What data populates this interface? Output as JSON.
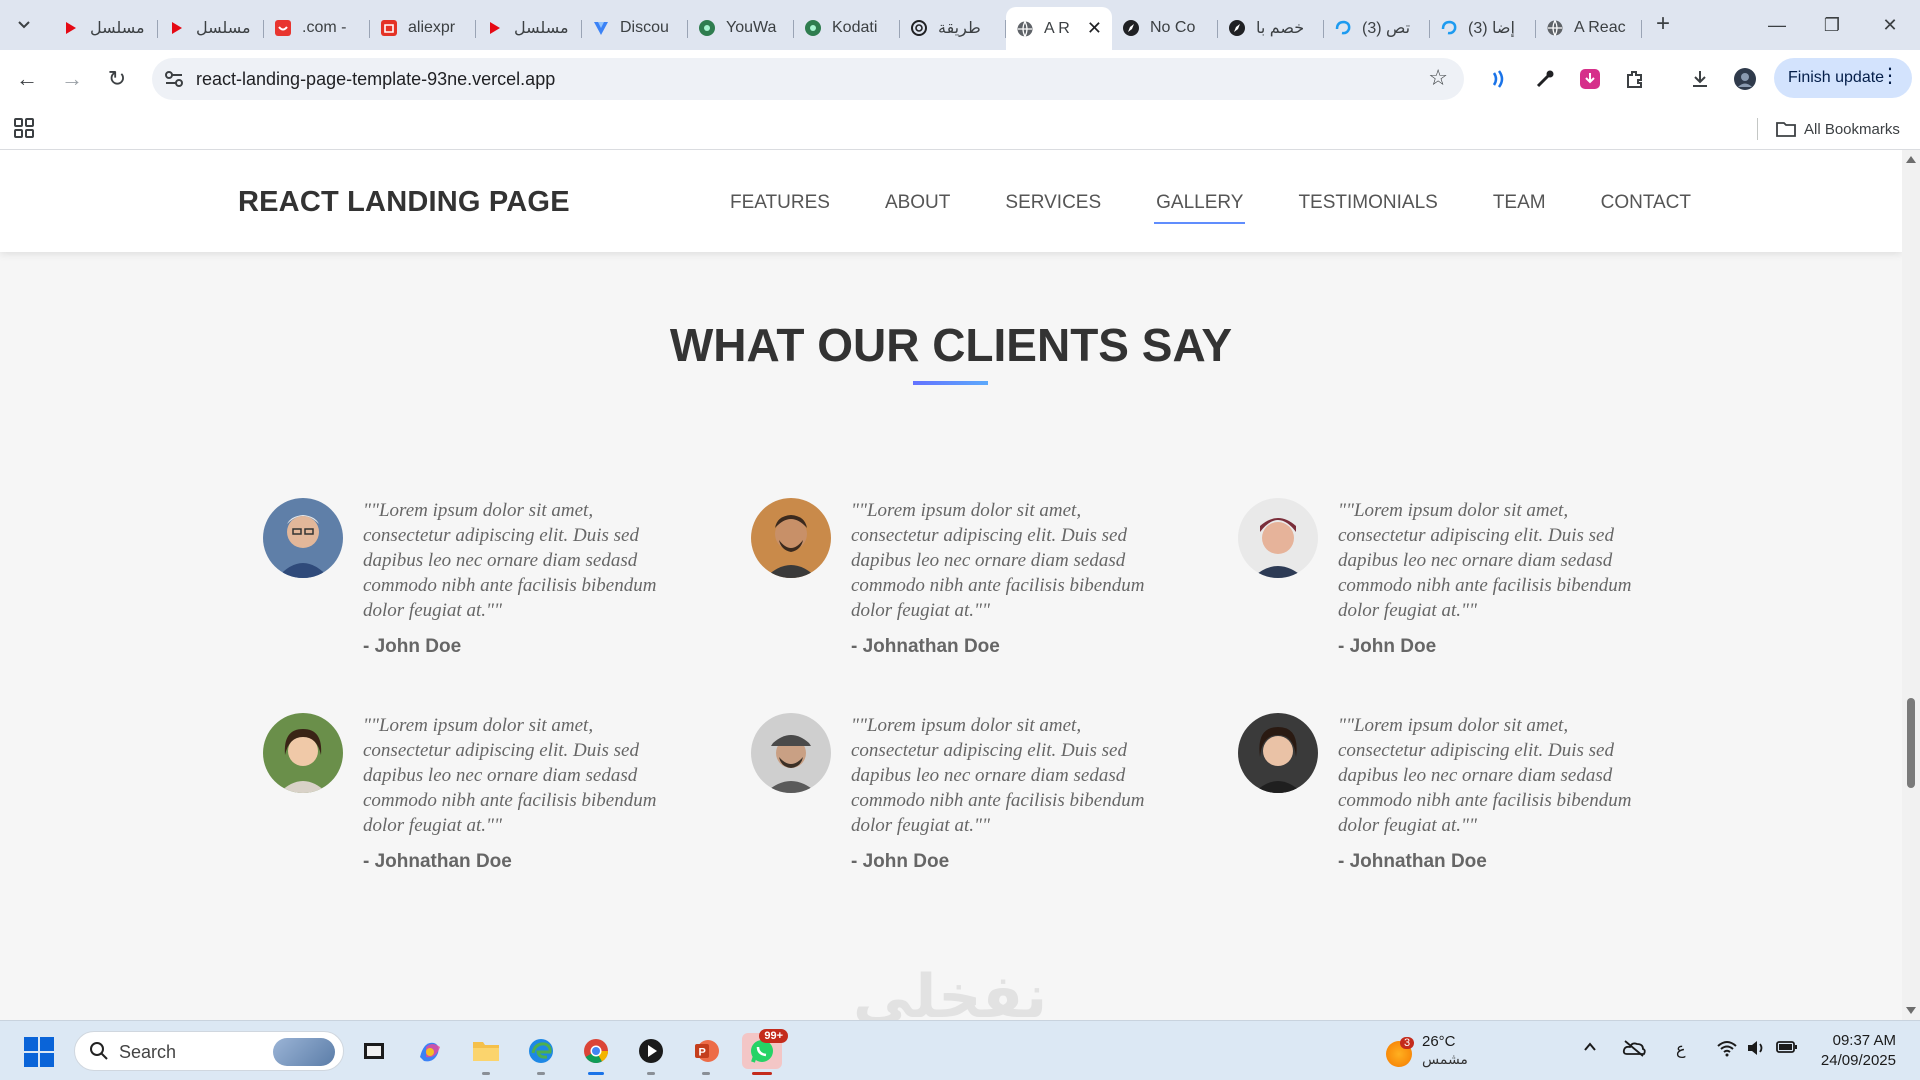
{
  "browser": {
    "tabs": [
      {
        "title": "مسلسل",
        "icon": "red-play-icon"
      },
      {
        "title": "مسلسل",
        "icon": "red-play-icon"
      },
      {
        "title": ".com -",
        "icon": "red-square-icon"
      },
      {
        "title": "aliexpr",
        "icon": "aliexpress-icon"
      },
      {
        "title": "مسلسل",
        "icon": "red-play-icon"
      },
      {
        "title": "Discou",
        "icon": "discourse-icon"
      },
      {
        "title": "YouWa",
        "icon": "green-hex-icon"
      },
      {
        "title": "Kodati",
        "icon": "green-hex-icon"
      },
      {
        "title": "طريقة",
        "icon": "openai-icon"
      },
      {
        "title": "A R",
        "icon": "globe-icon",
        "active": true
      },
      {
        "title": "No Co",
        "icon": "compass-icon"
      },
      {
        "title": "خصم با",
        "icon": "compass-icon"
      },
      {
        "title": "(3) تص",
        "icon": "blue-swirl-icon"
      },
      {
        "title": "(3) إضا",
        "icon": "blue-swirl-icon"
      },
      {
        "title": "A Reac",
        "icon": "globe-icon"
      }
    ],
    "url": "react-landing-page-template-93ne.vercel.app",
    "finish_update": "Finish update",
    "all_bookmarks": "All Bookmarks"
  },
  "site": {
    "brand": "REACT LANDING PAGE",
    "menu": [
      "FEATURES",
      "ABOUT",
      "SERVICES",
      "GALLERY",
      "TESTIMONIALS",
      "TEAM",
      "CONTACT"
    ],
    "active_menu": "GALLERY",
    "section_title": "WHAT OUR CLIENTS SAY",
    "testimonials": [
      {
        "quote": "\"\"Lorem ipsum dolor sit amet, consectetur adipiscing elit. Duis sed dapibus leo nec ornare diam sedasd commodo nibh ante facilisis bibendum dolor feugiat at.\"\"",
        "name": "- John Doe"
      },
      {
        "quote": "\"\"Lorem ipsum dolor sit amet, consectetur adipiscing elit. Duis sed dapibus leo nec ornare diam sedasd commodo nibh ante facilisis bibendum dolor feugiat at.\"\"",
        "name": "- Johnathan Doe"
      },
      {
        "quote": "\"\"Lorem ipsum dolor sit amet, consectetur adipiscing elit. Duis sed dapibus leo nec ornare diam sedasd commodo nibh ante facilisis bibendum dolor feugiat at.\"\"",
        "name": "- John Doe"
      },
      {
        "quote": "\"\"Lorem ipsum dolor sit amet, consectetur adipiscing elit. Duis sed dapibus leo nec ornare diam sedasd commodo nibh ante facilisis bibendum dolor feugiat at.\"\"",
        "name": "- Johnathan Doe"
      },
      {
        "quote": "\"\"Lorem ipsum dolor sit amet, consectetur adipiscing elit. Duis sed dapibus leo nec ornare diam sedasd commodo nibh ante facilisis bibendum dolor feugiat at.\"\"",
        "name": "- John Doe"
      },
      {
        "quote": "\"\"Lorem ipsum dolor sit amet, consectetur adipiscing elit. Duis sed dapibus leo nec ornare diam sedasd commodo nibh ante facilisis bibendum dolor feugiat at.\"\"",
        "name": "- Johnathan Doe"
      }
    ],
    "watermark": "نفخلي",
    "accent": "#608dfd"
  },
  "taskbar": {
    "search_placeholder": "Search",
    "whatsapp_badge": "99+",
    "weather_badge": "3",
    "weather_temp": "26°C",
    "weather_condition": "مشمس",
    "keyboard_lang": "ع",
    "time": "09:37 AM",
    "date": "24/09/2025"
  }
}
